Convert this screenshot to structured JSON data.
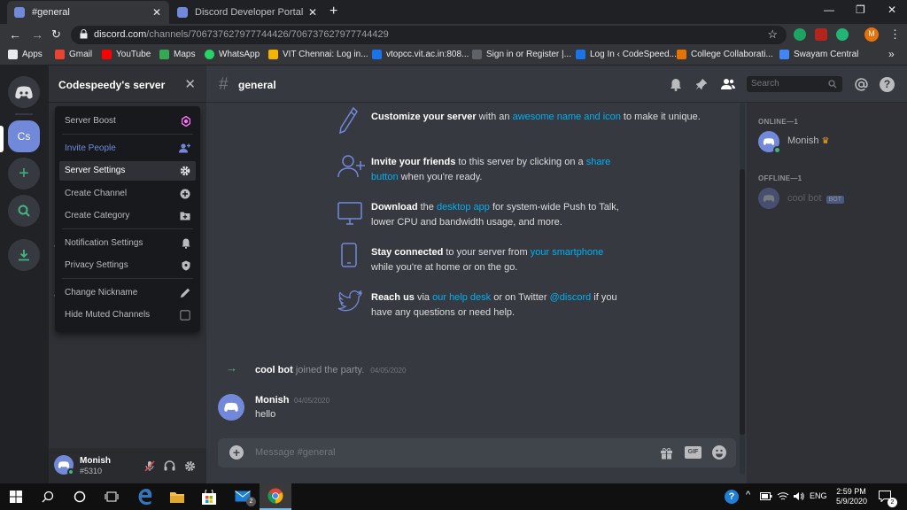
{
  "browser": {
    "tabs": [
      {
        "title": "#general",
        "close": "✕"
      },
      {
        "title": "Discord Developer Portal — My A",
        "close": "✕"
      }
    ],
    "new_tab": "+",
    "window_controls": [
      "—",
      "❐",
      "✕"
    ],
    "url_host": "discord.com",
    "url_path": "/channels/706737627977744426/706737627977744429",
    "bookmarks": [
      {
        "label": "Apps",
        "color": "#e8eaed"
      },
      {
        "label": "Gmail",
        "color": "#ea4335"
      },
      {
        "label": "YouTube",
        "color": "#ff0000"
      },
      {
        "label": "Maps",
        "color": "#34a853"
      },
      {
        "label": "WhatsApp",
        "color": "#25d366"
      },
      {
        "label": "VIT Chennai: Log in...",
        "color": "#f4b400"
      },
      {
        "label": "vtopcc.vit.ac.in:808...",
        "color": "#1a73e8"
      },
      {
        "label": "Sign in or Register |...",
        "color": "#5f6368"
      },
      {
        "label": "Log In ‹ CodeSpeed...",
        "color": "#1a73e8"
      },
      {
        "label": "College Collaborati...",
        "color": "#e37400"
      },
      {
        "label": "Swayam Central",
        "color": "#4285f4"
      }
    ],
    "more_bookmarks": "»",
    "profile_initial": "M"
  },
  "discord": {
    "server_name": "Codespeedy's server",
    "server_acronym": "Cs",
    "channel_name": "general",
    "search_placeholder": "Search",
    "menu": [
      {
        "label": "Server Boost",
        "color": "#b9bbbe",
        "icon": "boost-icon"
      },
      {
        "label": "Invite People",
        "color": "#7289da",
        "icon": "invite-icon"
      },
      {
        "label": "Server Settings",
        "color": "#ffffff",
        "icon": "gear-icon"
      },
      {
        "label": "Create Channel",
        "color": "#b9bbbe",
        "icon": "plus-circle-icon"
      },
      {
        "label": "Create Category",
        "color": "#b9bbbe",
        "icon": "folder-plus-icon"
      },
      {
        "label": "Notification Settings",
        "color": "#b9bbbe",
        "icon": "bell-icon"
      },
      {
        "label": "Privacy Settings",
        "color": "#b9bbbe",
        "icon": "shield-icon"
      },
      {
        "label": "Change Nickname",
        "color": "#b9bbbe",
        "icon": "pencil-icon"
      },
      {
        "label": "Hide Muted Channels",
        "color": "#b9bbbe",
        "icon": "checkbox-icon"
      }
    ],
    "tips": [
      {
        "bold": "Customize your server",
        "pre": " with an ",
        "link": "awesome name and icon",
        "post": " to make it unique."
      },
      {
        "bold": "Invite your friends",
        "pre": " to this server by clicking on a ",
        "link": "share button",
        "post": " when you're ready."
      },
      {
        "bold": "Download",
        "pre": " the ",
        "link": "desktop app",
        "post": " for system-wide Push to Talk, lower CPU and bandwidth usage, and more."
      },
      {
        "bold": "Stay connected",
        "pre": " to your server from ",
        "link": "your smartphone",
        "post": " while you're at home or on the go."
      },
      {
        "bold": "Reach us",
        "pre": " via ",
        "link": "our help desk",
        "post": " or on Twitter ",
        "link2": "@discord",
        "post2": " if you have any questions or need help."
      }
    ],
    "join_message": {
      "user": "cool bot",
      "text": " joined the party.",
      "date": "04/05/2020"
    },
    "message": {
      "user": "Monish",
      "date": "04/05/2020",
      "text": "hello"
    },
    "input_placeholder": "Message #general",
    "gif_label": "GIF",
    "online_header": "ONLINE—1",
    "offline_header": "OFFLINE—1",
    "online_member": "Monish",
    "offline_member": "cool bot",
    "bot_tag": "BOT",
    "user": {
      "name": "Monish",
      "tag": "#5310"
    }
  },
  "taskbar": {
    "language": "ENG",
    "time": "2:59 PM",
    "date": "5/9/2020",
    "mail_badge": "2",
    "notification_count": "2"
  }
}
